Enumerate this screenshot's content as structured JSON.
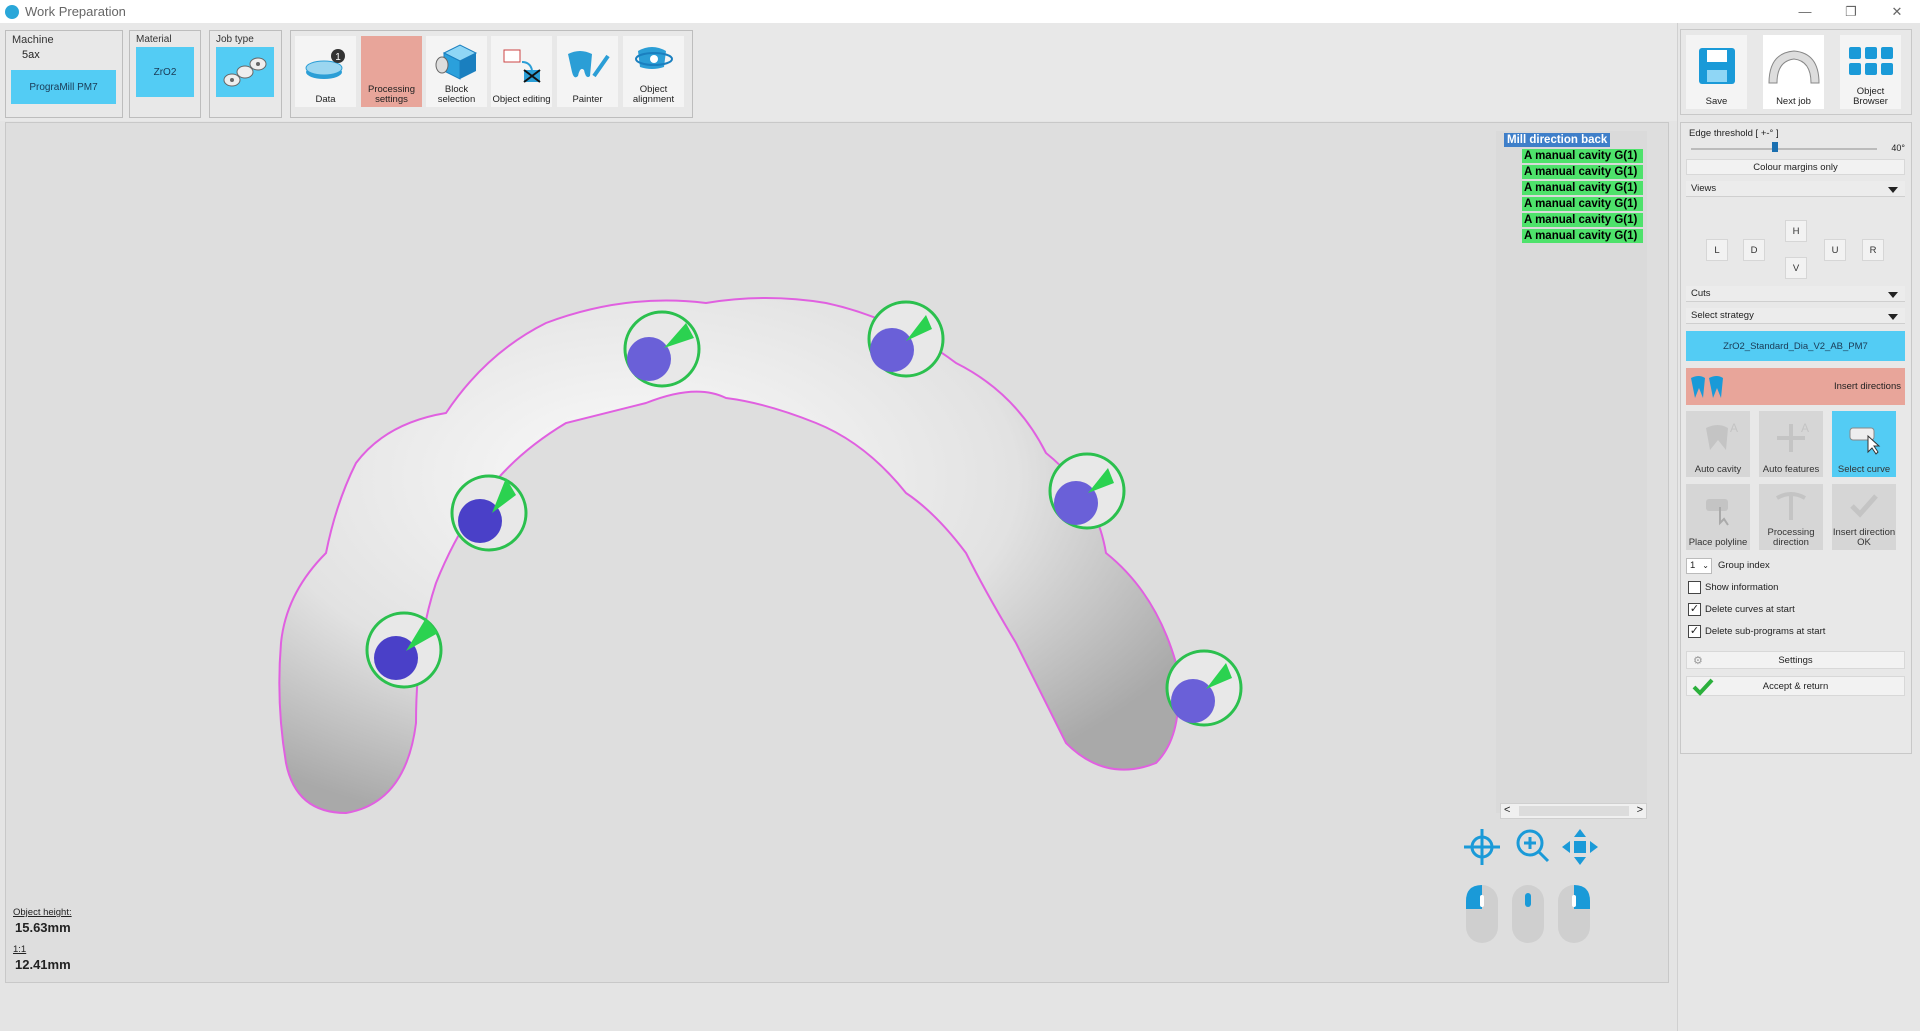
{
  "window": {
    "title": "Work Preparation",
    "min": "—",
    "restore": "❐",
    "close": "✕"
  },
  "toolbar": {
    "machine_label": "Machine",
    "machine_value": "5ax",
    "machine_name": "PrograMill PM7",
    "material_label": "Material",
    "material_value": "ZrO2",
    "jobtype_label": "Job type",
    "buttons": [
      {
        "label": "Data"
      },
      {
        "label": "Processing settings"
      },
      {
        "label": "Block selection"
      },
      {
        "label": "Object editing"
      },
      {
        "label": "Painter"
      },
      {
        "label": "Object alignment"
      }
    ],
    "data_badge": "1",
    "right_buttons": [
      {
        "label": "Save"
      },
      {
        "label": "Next job"
      },
      {
        "label": "Object Browser"
      }
    ]
  },
  "tree": {
    "root": "Mill direction back",
    "items": [
      "A manual cavity G(1)",
      "A manual cavity G(1)",
      "A manual cavity G(1)",
      "A manual cavity G(1)",
      "A manual cavity G(1)",
      "A manual cavity G(1)"
    ],
    "scroll_left": "<",
    "scroll_right": ">"
  },
  "info": {
    "object_height_label": "Object height:",
    "object_height_value": "15.63mm",
    "scale_label": "1:1",
    "scale_value": "12.41mm"
  },
  "panel": {
    "edge_threshold_label": "Edge threshold [ +-° ]",
    "edge_threshold_value": "40°",
    "edge_threshold_fraction": 0.45,
    "colour_margins_label": "Colour margins only",
    "views_label": "Views",
    "views": {
      "h": "H",
      "l": "L",
      "d": "D",
      "v": "V",
      "u": "U",
      "r": "R"
    },
    "cuts_label": "Cuts",
    "strategy_label": "Select strategy",
    "strategy_value": "ZrO2_Standard_Dia_V2_AB_PM7",
    "insert_directions_label": "Insert directions",
    "tools": [
      {
        "label": "Auto cavity"
      },
      {
        "label": "Auto features"
      },
      {
        "label": "Select curve"
      },
      {
        "label": "Place polyline"
      },
      {
        "label": "Processing direction"
      },
      {
        "label": "Insert direction OK"
      }
    ],
    "group_index_value": "1",
    "group_index_label": "Group index",
    "show_information_label": "Show information",
    "show_information_checked": "",
    "delete_curves_label": "Delete curves at start",
    "delete_curves_checked": "✓",
    "delete_subprograms_label": "Delete sub-programs at start",
    "delete_subprograms_checked": "✓",
    "settings_label": "Settings",
    "accept_label": "Accept & return"
  },
  "colors": {
    "accent_blue": "#53ccf4",
    "active_red": "#e8a59a",
    "tree_green": "#4ee26b",
    "margin_magenta": "#e060e0"
  }
}
